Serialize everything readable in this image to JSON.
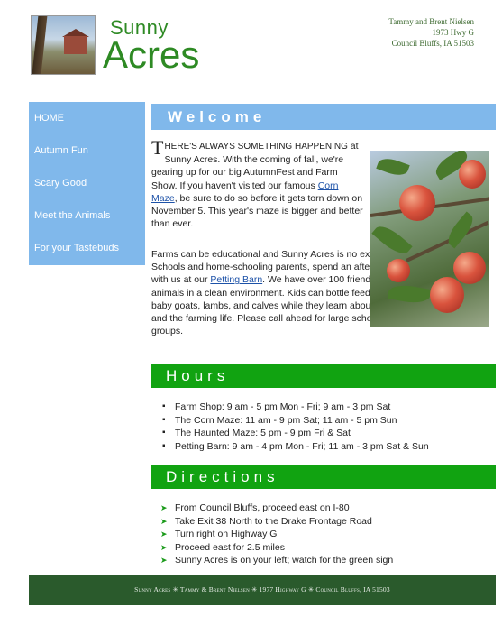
{
  "header": {
    "title_line1": "Sunny",
    "title_line2": "Acres",
    "address": [
      "Tammy and Brent Nielsen",
      "1973 Hwy G",
      "Council Bluffs, IA  51503"
    ]
  },
  "nav": [
    {
      "label": "HOME"
    },
    {
      "label": "Autumn Fun"
    },
    {
      "label": "Scary Good"
    },
    {
      "label": "Meet the Animals"
    },
    {
      "label": "For your Tastebuds"
    }
  ],
  "welcome": {
    "heading": "Welcome",
    "p1_drop": "T",
    "p1_caps": "HERE'S ALWAYS SOMETHING HAPPENING",
    "p1_a": " at Sunny Acres. With the coming of fall, we're gearing up for our big AutumnFest and Farm Show. If you haven't visited our famous ",
    "p1_link": "Corn Maze",
    "p1_b": ", be sure to do so before it gets torn down on November 5. This year's maze is bigger and better than ever.",
    "p2_a": "Farms can be educational and Sunny Acres is no exception. Schools and home-schooling parents, spend an afternoon with us at our ",
    "p2_link": "Petting Barn",
    "p2_b": ". We have over 100 friendly farm animals in a clean environment. Kids can bottle feed the baby goats, lambs, and calves while they learn about nature and the farming life. Please call ahead for large school groups."
  },
  "hours": {
    "heading": "Hours",
    "items": [
      "Farm Shop: 9 am - 5 pm Mon - Fri; 9 am - 3 pm Sat",
      "The Corn Maze: 11 am - 9 pm Sat; 11 am - 5 pm Sun",
      "The Haunted Maze: 5 pm - 9 pm Fri & Sat",
      "Petting Barn: 9 am - 4 pm Mon - Fri; 11 am - 3 pm Sat & Sun"
    ]
  },
  "directions": {
    "heading": "Directions",
    "items": [
      "From Council Bluffs, proceed east on I-80",
      "Take Exit 38 North to the Drake Frontage Road",
      "Turn right on Highway G",
      "Proceed east for 2.5 miles",
      "Sunny Acres is on your left; watch for the green sign"
    ]
  },
  "footer": {
    "text": "Sunny Acres ✳ Tammy & Brent Nielsen ✳ 1977 Highway G ✳ Council Bluffs, IA    51503"
  },
  "colors": {
    "nav_bg": "#80b8eb",
    "green_bar": "#11a311",
    "title_green": "#2e8a24",
    "footer_bg": "#2a5a2c",
    "link": "#1d52a8"
  }
}
